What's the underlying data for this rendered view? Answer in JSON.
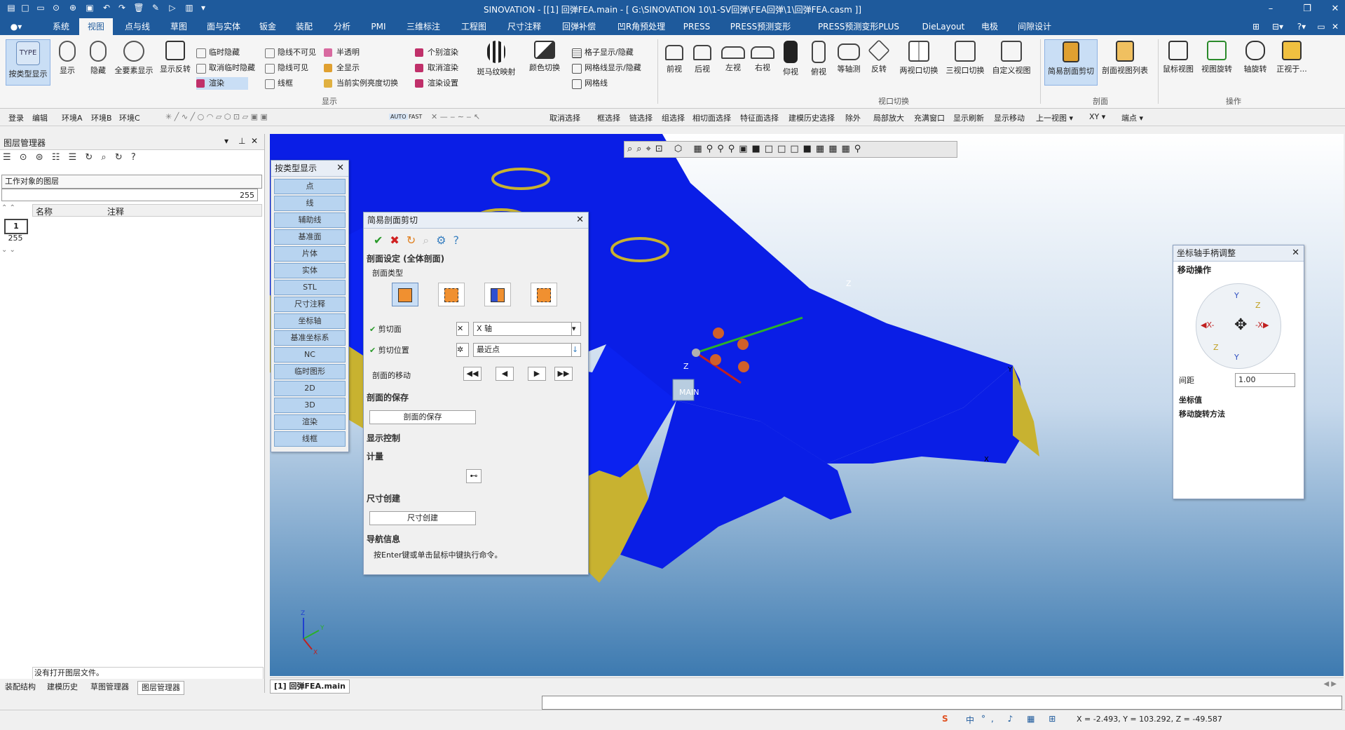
{
  "title": "SINOVATION - [[1] 回弹FEA.main - [ G:\\SINOVATION 10\\1-SV回弹\\FEA回弹\\1\\回弹FEA.casm ]]",
  "tabs": [
    "系统",
    "视图",
    "点与线",
    "草图",
    "面与实体",
    "钣金",
    "装配",
    "分析",
    "PMI",
    "三维标注",
    "工程图",
    "尺寸注释",
    "回弹补偿",
    "凹R角预处理",
    "PRESS",
    "PRESS预测变形",
    "PRESS预测变形PLUS",
    "DieLayout",
    "电极",
    "间隙设计"
  ],
  "ribbon": {
    "display_big": [
      "按类型显示",
      "显示",
      "隐藏",
      "全要素显示",
      "显示反转"
    ],
    "display_small_col1": [
      "临时隐藏",
      "取消临时隐藏",
      "渲染"
    ],
    "display_small_col2": [
      "隐线不可见",
      "隐线可见",
      "线框"
    ],
    "display_small_col3": [
      "半透明",
      "全显示",
      "当前实例亮度切换"
    ],
    "display_small_col4": [
      "个别渲染",
      "取消渲染",
      "渲染设置"
    ],
    "display_big2": [
      "斑马纹映射",
      "颜色切换"
    ],
    "display_small_col5": [
      "格子显示/隐藏",
      "网格线显示/隐藏",
      "网格线"
    ],
    "group_display": "显示",
    "view_big": [
      "前视",
      "后视",
      "左视",
      "右视",
      "仰视",
      "俯视",
      "等轴测",
      "反转",
      "两视口切换",
      "三视口切换",
      "自定义视图"
    ],
    "group_viewport": "视口切换",
    "section_big": [
      "简易剖面剪切",
      "剖面视图列表"
    ],
    "group_section": "剖面",
    "op_big": [
      "鼠标视图",
      "视图旋转",
      "轴旋转",
      "正视于..."
    ],
    "group_op": "操作"
  },
  "toolbar2": {
    "left": [
      "登录",
      "编辑",
      "环境A",
      "环境B",
      "环境C"
    ],
    "mid": [
      "AUTO",
      "FAST"
    ],
    "right": [
      "取消选择",
      "框选择",
      "链选择",
      "组选择",
      "相切面选择",
      "特征面选择",
      "建模历史选择",
      "除外",
      "局部放大",
      "充满窗口",
      "显示刷新",
      "显示移动",
      "上一视图 ▾",
      "XY ▾",
      "端点 ▾"
    ]
  },
  "layer_panel": {
    "title": "图层管理器",
    "dropdown": "工作对象的图层",
    "count": "255",
    "col_name": "名称",
    "col_note": "注释",
    "layer_cur": "1",
    "layer_max": "255",
    "no_file": "没有打开图层文件。"
  },
  "bottom_tabs": [
    "装配结构",
    "建模历史",
    "草图管理器",
    "图层管理器"
  ],
  "doc_tab": "[1] 回弹FEA.main",
  "type_display": {
    "title": "按类型显示",
    "items": [
      "点",
      "线",
      "辅助线",
      "基准面",
      "片体",
      "实体",
      "STL",
      "尺寸注释",
      "坐标轴",
      "基准坐标系",
      "NC",
      "临时图形",
      "2D",
      "3D",
      "渲染",
      "线框"
    ]
  },
  "section_dialog": {
    "title": "简易剖面剪切",
    "sect_setting": "剖面设定 (全体剖面)",
    "sect_type": "剖面类型",
    "cut_plane_label": "剪切面",
    "cut_plane_value": "X 轴",
    "cut_pos_label": "剪切位置",
    "cut_pos_value": "最近点",
    "move_label": "剖面的移动",
    "save_section": "剖面的保存",
    "save_button": "剖面的保存",
    "display_ctrl": "显示控制",
    "measure": "计量",
    "dim_create": "尺寸创建",
    "dim_button": "尺寸创建",
    "nav": "导航信息",
    "nav_text": "按Enter键或单击鼠标中键执行命令。"
  },
  "axis_panel": {
    "title": "坐标轴手柄调整",
    "move_op": "移动操作",
    "spacing_label": "间距",
    "spacing_value": "1.00",
    "coord_value": "坐标值",
    "move_method": "移动旋转方法"
  },
  "viewport": {
    "label_z": "Z",
    "label_y": "Y",
    "label_x": "X",
    "label_main": "MAIN"
  },
  "status": {
    "coords": "X =    -2.493, Y =   103.292, Z =    -49.587",
    "ime": "中"
  },
  "colors": {
    "titlebar": "#1e5a9c",
    "part_blue": "#0a1ee6",
    "part_yellow": "#c8b230"
  }
}
